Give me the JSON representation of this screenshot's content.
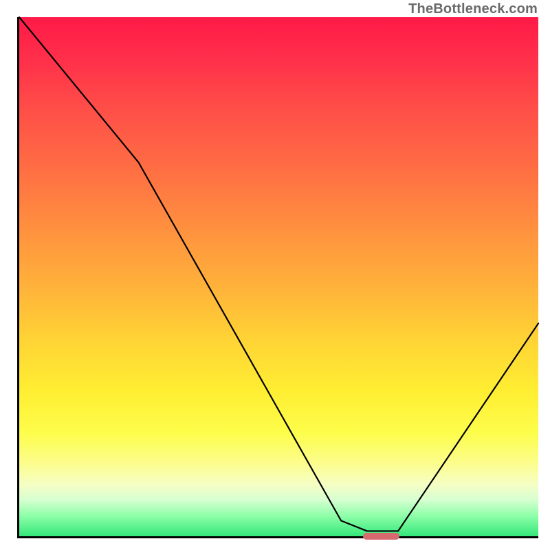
{
  "watermark": "TheBottleneck.com",
  "chart_data": {
    "type": "line",
    "title": "",
    "xlabel": "",
    "ylabel": "",
    "xlim": [
      0,
      100
    ],
    "ylim": [
      0,
      100
    ],
    "series": [
      {
        "name": "bottleneck-curve",
        "x": [
          0,
          23,
          62,
          67,
          73,
          100
        ],
        "values": [
          100,
          72,
          3,
          1,
          1,
          41
        ]
      }
    ],
    "annotations": [
      {
        "name": "optimum-range",
        "x_start": 66,
        "x_end": 73,
        "y": 0
      }
    ]
  },
  "optimum": {
    "left_pct": 66,
    "width_pct": 7
  },
  "colors": {
    "curve": "#000000",
    "marker": "#d86a6f",
    "axis": "#000000"
  }
}
